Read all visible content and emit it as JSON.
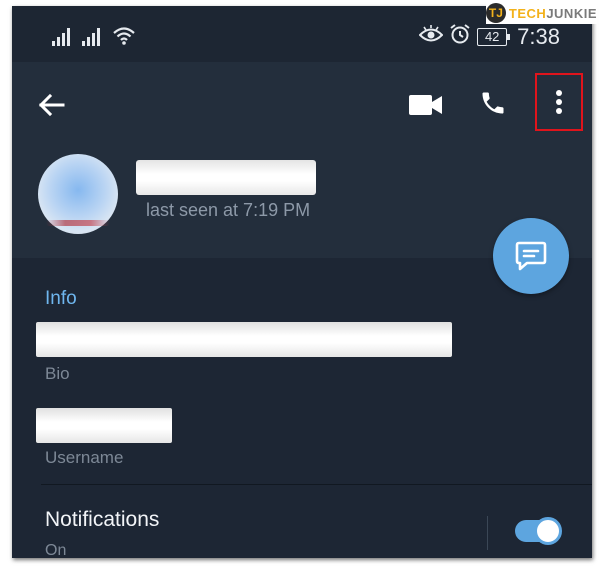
{
  "status_bar": {
    "signal_icons": [
      "signal-icon",
      "signal-icon",
      "wifi-icon"
    ],
    "right_icons": [
      "eye-icon",
      "alarm-icon"
    ],
    "battery": "42",
    "time": "7:38"
  },
  "header": {
    "actions": [
      "back-arrow-icon",
      "video-call-icon",
      "phone-icon",
      "more-vert-icon"
    ],
    "status": "last seen at 7:19 PM"
  },
  "info": {
    "title": "Info",
    "bio_label": "Bio",
    "username_label": "Username"
  },
  "notifications": {
    "title": "Notifications",
    "status": "On",
    "enabled": true
  },
  "watermark": {
    "mark": "TJ",
    "tech": "TECH",
    "junkie": "JUNKIE"
  },
  "colors": {
    "header_bg": "#232e3c",
    "content_bg": "#1d2634",
    "accent": "#5da5df",
    "highlight_box": "#e0141c"
  }
}
